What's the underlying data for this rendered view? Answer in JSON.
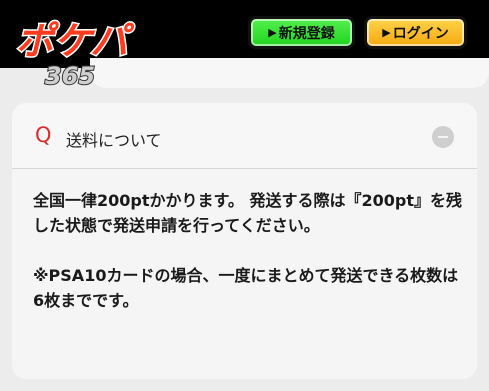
{
  "header": {
    "logo_text": "ポケパ",
    "logo_sub": "365",
    "register_button": "新規登録",
    "login_button": "ログイン",
    "button_arrow": "▶"
  },
  "faq": {
    "q_mark": "Q",
    "question": "送料について",
    "answer_1": "全国一律200ptかかります。 発送する際は『200pt』を残した状態で発送申請を行ってください。",
    "answer_2": "※PSA10カードの場合、一度にまとめて発送できる枚数は6枚までです。"
  },
  "colors": {
    "register": "#2ad429",
    "login": "#f8b31c",
    "q_mark": "#d62d2d",
    "header_bg": "#000000"
  },
  "icons": {
    "toggle": "minus-circle-icon"
  }
}
